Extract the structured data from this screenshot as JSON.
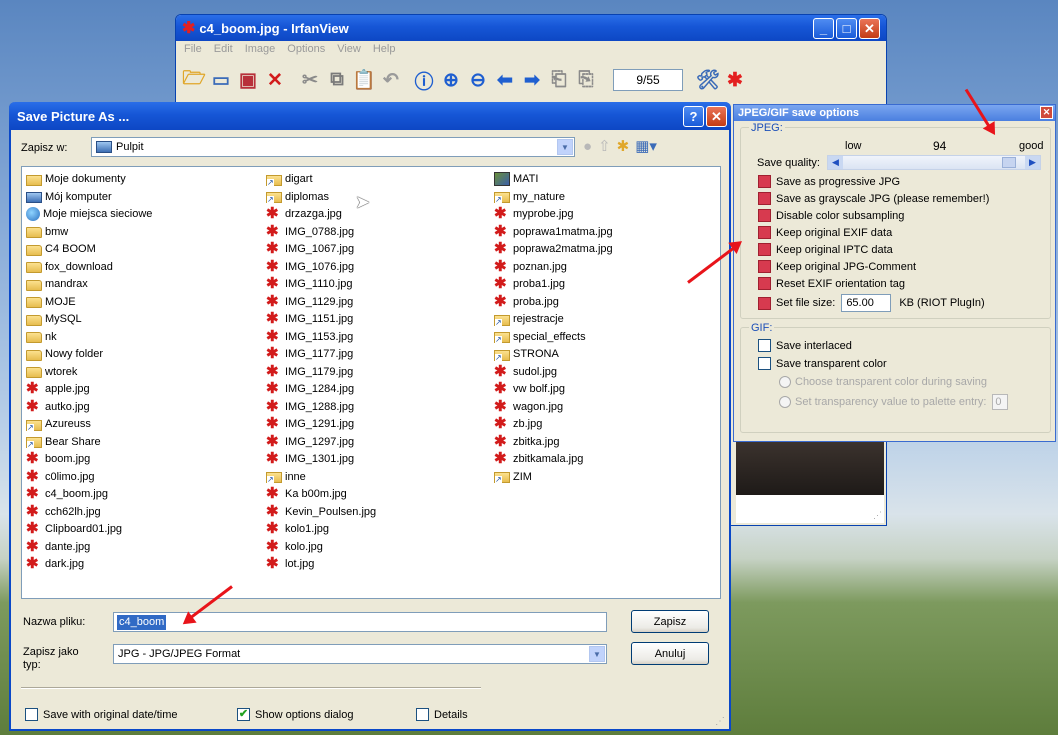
{
  "irfanview": {
    "title": "c4_boom.jpg - IrfanView",
    "menu": [
      "File",
      "Edit",
      "Image",
      "Options",
      "View",
      "Help"
    ],
    "page_counter": "9/55"
  },
  "dialog": {
    "title": "Save Picture As ...",
    "help_label": "?",
    "close_label": "✕",
    "save_in_label": "Zapisz w:",
    "save_in_value": "Pulpit",
    "files_col1": [
      {
        "name": "Moje dokumenty",
        "icon": "documents-folder-icon"
      },
      {
        "name": "Mój komputer",
        "icon": "computer-icon"
      },
      {
        "name": "Moje miejsca sieciowe",
        "icon": "network-icon"
      },
      {
        "name": "bmw",
        "icon": "folder-icon"
      },
      {
        "name": "C4 BOOM",
        "icon": "folder-icon"
      },
      {
        "name": "fox_download",
        "icon": "folder-icon"
      },
      {
        "name": "mandrax",
        "icon": "folder-icon"
      },
      {
        "name": "MOJE",
        "icon": "folder-icon"
      },
      {
        "name": "MySQL",
        "icon": "folder-icon"
      },
      {
        "name": "nk",
        "icon": "folder-icon"
      },
      {
        "name": "Nowy folder",
        "icon": "folder-icon"
      },
      {
        "name": "wtorek",
        "icon": "folder-icon"
      },
      {
        "name": "apple.jpg",
        "icon": "jpg-icon"
      },
      {
        "name": "autko.jpg",
        "icon": "jpg-icon"
      },
      {
        "name": "Azureuss",
        "icon": "shortcut-folder-icon"
      },
      {
        "name": "Bear Share",
        "icon": "shortcut-folder-icon"
      },
      {
        "name": "boom.jpg",
        "icon": "jpg-icon"
      },
      {
        "name": "c0limo.jpg",
        "icon": "jpg-icon"
      },
      {
        "name": "c4_boom.jpg",
        "icon": "jpg-icon"
      },
      {
        "name": "cch62lh.jpg",
        "icon": "jpg-icon"
      },
      {
        "name": "Clipboard01.jpg",
        "icon": "jpg-icon"
      },
      {
        "name": "dante.jpg",
        "icon": "jpg-icon"
      },
      {
        "name": "dark.jpg",
        "icon": "jpg-icon"
      }
    ],
    "files_col2": [
      {
        "name": "digart",
        "icon": "shortcut-folder-icon"
      },
      {
        "name": "diplomas",
        "icon": "shortcut-folder-icon"
      },
      {
        "name": "drzazga.jpg",
        "icon": "jpg-icon"
      },
      {
        "name": "IMG_0788.jpg",
        "icon": "jpg-icon"
      },
      {
        "name": "IMG_1067.jpg",
        "icon": "jpg-icon"
      },
      {
        "name": "IMG_1076.jpg",
        "icon": "jpg-icon"
      },
      {
        "name": "IMG_1110.jpg",
        "icon": "jpg-icon"
      },
      {
        "name": "IMG_1129.jpg",
        "icon": "jpg-icon"
      },
      {
        "name": "IMG_1151.jpg",
        "icon": "jpg-icon"
      },
      {
        "name": "IMG_1153.jpg",
        "icon": "jpg-icon"
      },
      {
        "name": "IMG_1177.jpg",
        "icon": "jpg-icon"
      },
      {
        "name": "IMG_1179.jpg",
        "icon": "jpg-icon"
      },
      {
        "name": "IMG_1284.jpg",
        "icon": "jpg-icon"
      },
      {
        "name": "IMG_1288.jpg",
        "icon": "jpg-icon"
      },
      {
        "name": "IMG_1291.jpg",
        "icon": "jpg-icon"
      },
      {
        "name": "IMG_1297.jpg",
        "icon": "jpg-icon"
      },
      {
        "name": "IMG_1301.jpg",
        "icon": "jpg-icon"
      },
      {
        "name": "inne",
        "icon": "shortcut-folder-icon"
      },
      {
        "name": "Ka b00m.jpg",
        "icon": "jpg-icon"
      },
      {
        "name": "Kevin_Poulsen.jpg",
        "icon": "jpg-icon"
      },
      {
        "name": "kolo1.jpg",
        "icon": "jpg-icon"
      },
      {
        "name": "kolo.jpg",
        "icon": "jpg-icon"
      },
      {
        "name": "lot.jpg",
        "icon": "jpg-icon"
      }
    ],
    "files_col3": [
      {
        "name": "MATI",
        "icon": "image-icon"
      },
      {
        "name": "my_nature",
        "icon": "shortcut-folder-icon"
      },
      {
        "name": "myprobe.jpg",
        "icon": "jpg-icon"
      },
      {
        "name": "poprawa1matma.jpg",
        "icon": "jpg-icon"
      },
      {
        "name": "poprawa2matma.jpg",
        "icon": "jpg-icon"
      },
      {
        "name": "poznan.jpg",
        "icon": "jpg-icon"
      },
      {
        "name": "proba1.jpg",
        "icon": "jpg-icon"
      },
      {
        "name": "proba.jpg",
        "icon": "jpg-icon"
      },
      {
        "name": "rejestracje",
        "icon": "shortcut-folder-icon"
      },
      {
        "name": "special_effects",
        "icon": "shortcut-folder-icon"
      },
      {
        "name": "STRONA",
        "icon": "shortcut-folder-icon"
      },
      {
        "name": "sudol.jpg",
        "icon": "jpg-icon"
      },
      {
        "name": "vw bolf.jpg",
        "icon": "jpg-icon"
      },
      {
        "name": "wagon.jpg",
        "icon": "jpg-icon"
      },
      {
        "name": "zb.jpg",
        "icon": "jpg-icon"
      },
      {
        "name": "zbitka.jpg",
        "icon": "jpg-icon"
      },
      {
        "name": "zbitkamala.jpg",
        "icon": "jpg-icon"
      },
      {
        "name": "ZIM",
        "icon": "shortcut-folder-icon"
      }
    ],
    "filename_label": "Nazwa pliku:",
    "filename_value": "c4_boom",
    "filetype_label": "Zapisz jako typ:",
    "filetype_value": "JPG - JPG/JPEG Format",
    "save_button": "Zapisz",
    "cancel_button": "Anuluj",
    "opt_original_date": "Save with original date/time",
    "opt_show_options": "Show options dialog",
    "opt_details": "Details",
    "opt_original_date_checked": false,
    "opt_show_options_checked": true,
    "opt_details_checked": false
  },
  "jpeg_options": {
    "title": "JPEG/GIF save options",
    "close_label": "✕",
    "jpeg_group": "JPEG:",
    "low_label": "low",
    "quality_value": "94",
    "good_label": "good",
    "quality_label": "Save quality:",
    "quality_fraction": 0.94,
    "options": [
      "Save as progressive JPG",
      "Save as grayscale JPG (please remember!)",
      "Disable color subsampling",
      "Keep original EXIF data",
      "Keep original IPTC data",
      "Keep original JPG-Comment",
      "Reset EXIF orientation tag"
    ],
    "file_size_label": "Set file size:",
    "file_size_value": "65.00",
    "file_size_unit": "KB (RIOT PlugIn)",
    "gif_group": "GIF:",
    "gif_interlaced": "Save interlaced",
    "gif_transparent": "Save transparent color",
    "gif_choose": "Choose transparent color during saving",
    "gif_palette": "Set transparency value to palette entry:",
    "gif_palette_value": "0"
  },
  "colors": {
    "accent": "#0a5ad6",
    "annotation": "#e8141a",
    "checkbox_highlight": "#d73a4f"
  }
}
